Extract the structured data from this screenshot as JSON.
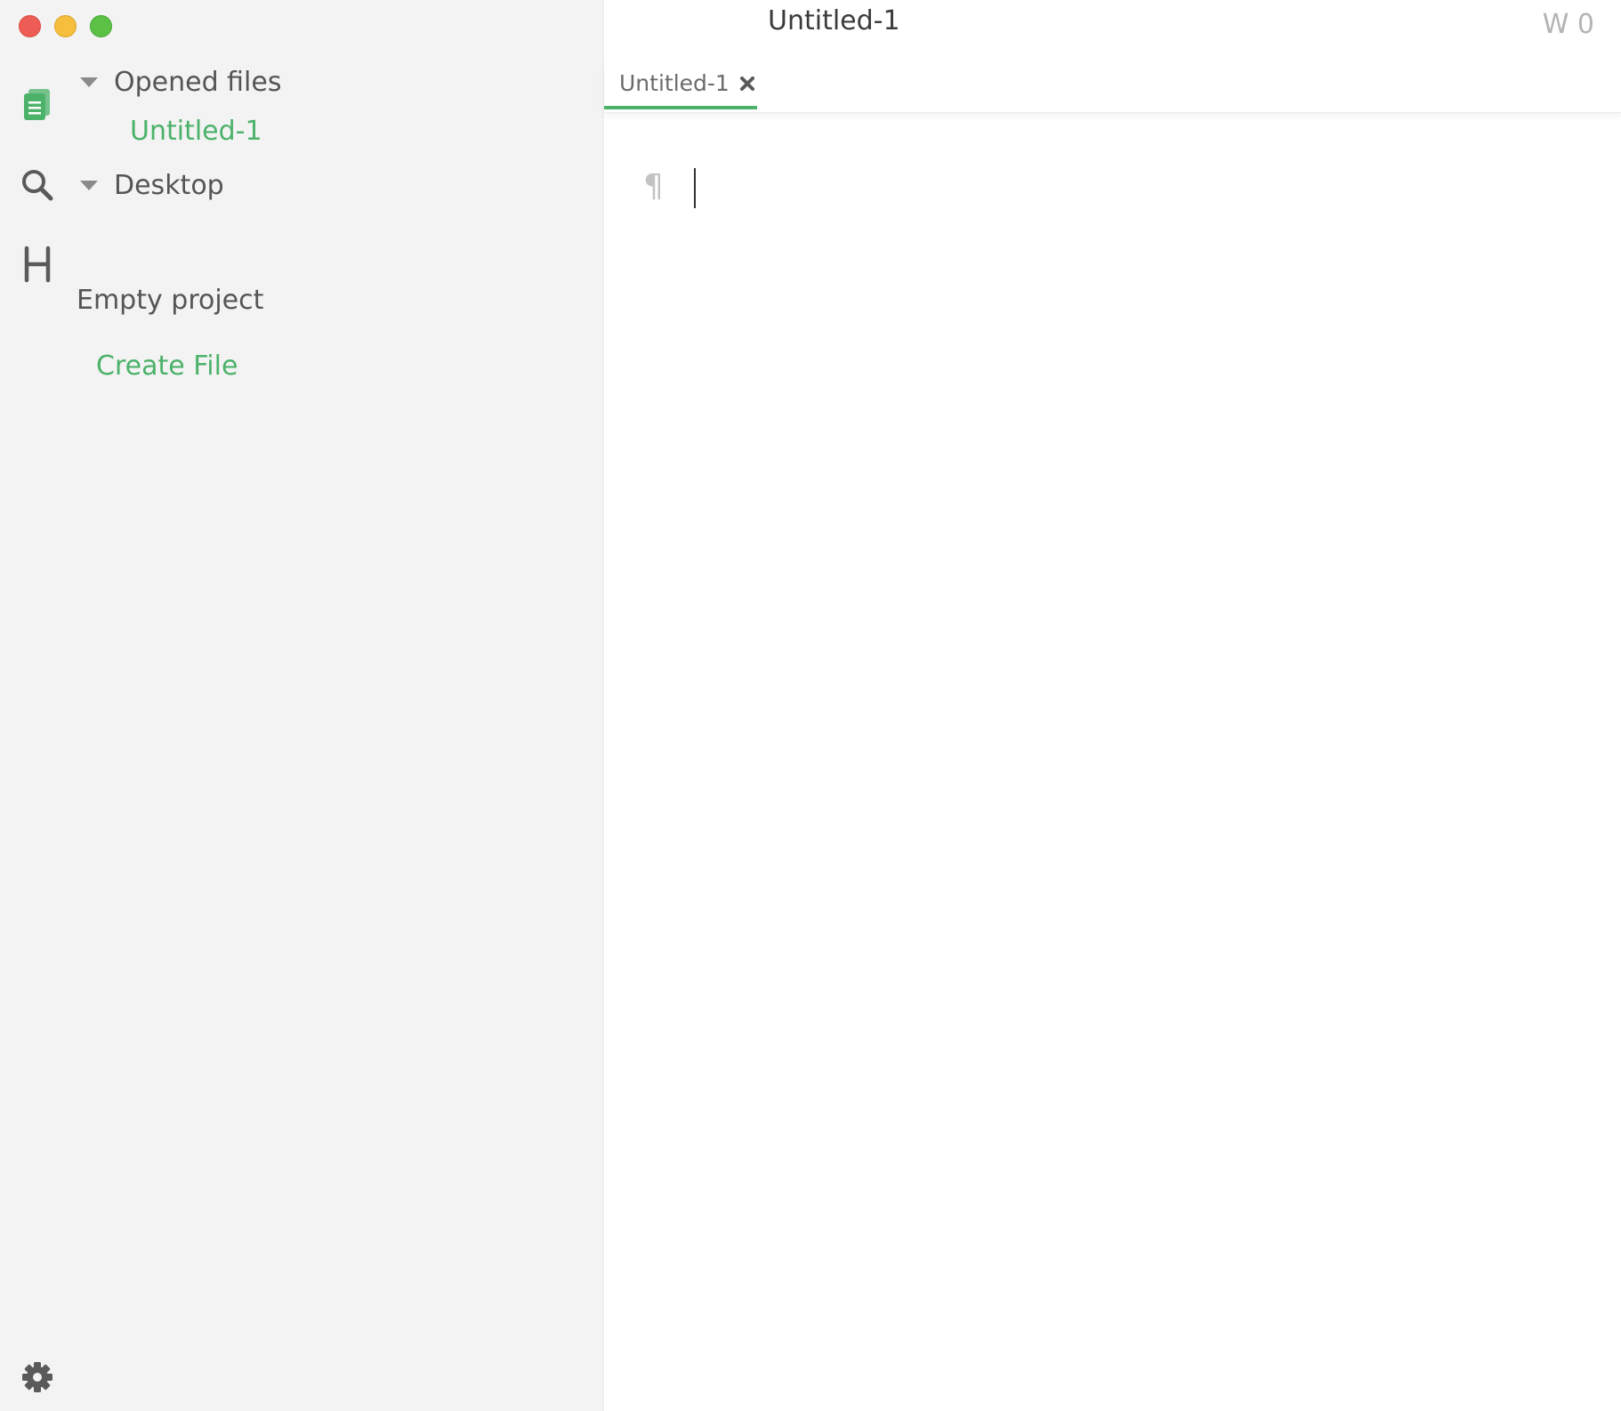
{
  "window": {
    "controls": [
      "close",
      "minimize",
      "maximize"
    ]
  },
  "sidebar": {
    "rail_icons": [
      "files-icon",
      "search-icon",
      "toc-icon",
      "settings-icon"
    ],
    "toc_glyph": "H",
    "opened_files": {
      "label": "Opened files",
      "items": [
        "Untitled-1"
      ]
    },
    "folder": {
      "label": "Desktop"
    },
    "empty_text": "Empty project",
    "create_file_label": "Create File"
  },
  "main": {
    "title": "Untitled-1",
    "word_count": "W 0",
    "tabs": [
      {
        "label": "Untitled-1",
        "active": true
      }
    ],
    "editor": {
      "paragraph_mark": "¶",
      "content": ""
    }
  },
  "colors": {
    "accent": "#4cb26a",
    "sidebar_bg": "#f3f3f3",
    "text": "#555555",
    "muted": "#b4b4b4"
  }
}
